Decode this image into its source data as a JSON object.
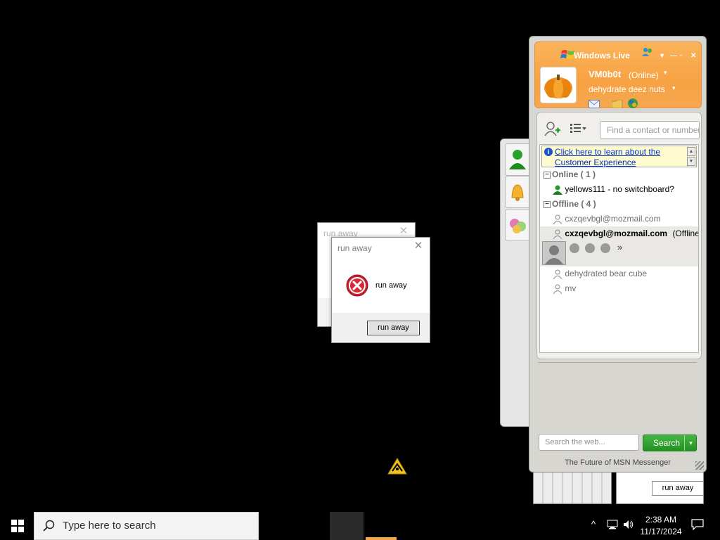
{
  "dialogs": {
    "back": {
      "title": "run away"
    },
    "front": {
      "title": "run away",
      "message": "run away",
      "ok_label": "run away"
    }
  },
  "messenger": {
    "brand": "Windows Live",
    "user": {
      "nick": "VM0b0t",
      "status": "(Online)",
      "personal_message": "dehydrate deez nuts"
    },
    "find_placeholder": "Find a contact or number",
    "info_bar": "Click here to learn about the Customer Experience",
    "groups": [
      {
        "name": "Online ( 1 )"
      },
      {
        "name": "Offline ( 4 )"
      }
    ],
    "contacts": {
      "online": [
        {
          "name": "yellows111 - no switchboard?"
        }
      ],
      "offline": [
        {
          "name": "cxzqevbgl@mozmail.com"
        },
        {
          "name": "cxzqevbgl@mozmail.com",
          "status": "(Offline)"
        },
        {
          "name": "dehydrated bear cube"
        },
        {
          "name": "mv"
        }
      ]
    },
    "selected_more": "»",
    "web_search_placeholder": "Search the web...",
    "search_label": "Search",
    "tagline": "The Future of MSN Messenger"
  },
  "runaway_mini": {
    "button_label": "run away"
  },
  "taskbar": {
    "search_placeholder": "Type here to search",
    "time": "2:38 AM",
    "date": "11/17/2024"
  },
  "colors": {
    "msn_orange": "#f7a243",
    "search_green": "#229121",
    "error_red": "#c8202c"
  }
}
